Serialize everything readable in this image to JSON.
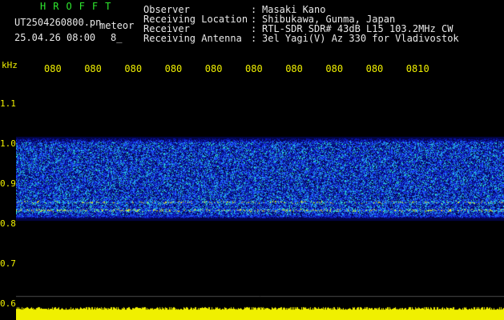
{
  "header": {
    "app_title": "HROFFT",
    "file_name": "UT2504260800.pn",
    "file_kind": "meteor",
    "date_time": "25.04.26 08:00",
    "tail": "8_",
    "meta": [
      {
        "label": "Observer",
        "sep": ":",
        "value": "Masaki Kano"
      },
      {
        "label": "Receiving Location",
        "sep": ":",
        "value": "Shibukawa, Gunma, Japan"
      },
      {
        "label": "Receiver",
        "sep": ":",
        "value": "RTL-SDR SDR# 43dB L15 103.2MHz CW"
      },
      {
        "label": "Receiving Antenna",
        "sep": ":",
        "value": "3el Yagi(V) Az 330 for Vladivostok"
      }
    ]
  },
  "chart_data": {
    "type": "heatmap",
    "ylabel": "kHz",
    "y_ticks": [
      "1.1",
      "1.0",
      "0.9",
      "0.8",
      "0.7",
      "0.6"
    ],
    "y_tick_values": [
      1.1,
      1.0,
      0.9,
      0.8,
      0.7,
      0.6
    ],
    "x_ticks": [
      "080",
      "080",
      "080",
      "080",
      "080",
      "080",
      "080",
      "080",
      "080",
      "0810"
    ],
    "band_khz": [
      0.81,
      1.02
    ],
    "signal_lines_khz": [
      0.835,
      0.82,
      0.855
    ],
    "colors": {
      "background": "#000000",
      "low": "#0a0aa0",
      "mid": "#1e46ff",
      "high": "#29d7d7",
      "peak": "#e6e61e",
      "level_bar": "#f0f000",
      "grid": "#4a4a4a"
    }
  }
}
